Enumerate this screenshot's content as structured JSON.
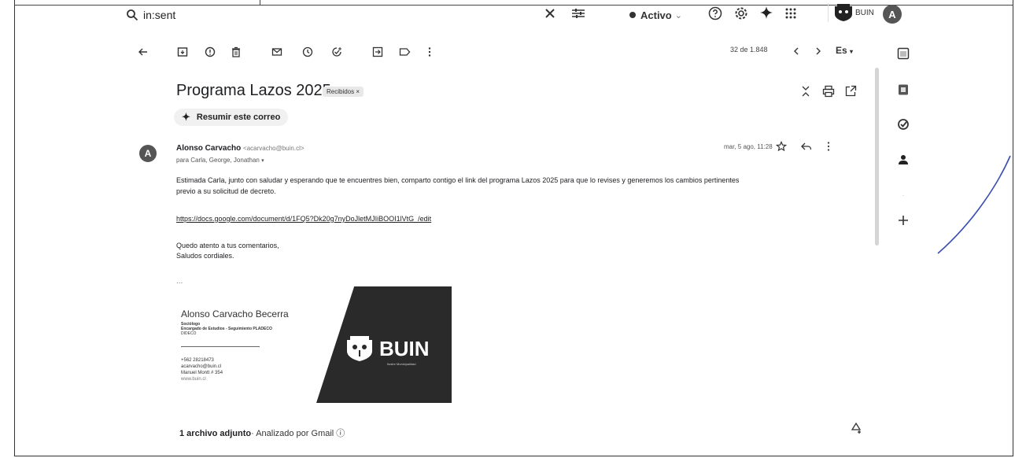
{
  "search": {
    "query": "in:sent"
  },
  "status": {
    "label": "Activo"
  },
  "account": {
    "brand": "BUIN",
    "avatar_letter": "A"
  },
  "toolbar": {
    "pager": "32 de 1.848",
    "lang": "Es"
  },
  "message": {
    "subject": "Programa Lazos 2025",
    "label_tag": "Recibidos ×",
    "summarize": "Resumir este correo",
    "sender_name": "Alonso Carvacho",
    "sender_email": "<acarvacho@buin.cl>",
    "recipients": "para Carla, George, Jonathan",
    "date": "mar, 5 ago, 11:28",
    "avatar_letter": "A",
    "body_line1": "Estimada Carla, junto con saludar y esperando que te encuentres bien, comparto contigo el link del programa Lazos 2025 para que lo revises y generemos los cambios pertinentes",
    "body_line2": "previo a su solicitud de decreto.",
    "link": "https://docs.google.com/document/d/1FQ5?Dk20g7nyDoJletMJIiBOOI1lVtG_/edit",
    "closing1": "Quedo atento a tus comentarios,",
    "closing2": "Saludos cordiales.",
    "sig_dots": "..."
  },
  "signature": {
    "name": "Alonso Carvacho Becerra",
    "role1": "Sociólogo",
    "role2": "Encargado de Estudios - Seguimiento PLADECO",
    "role3": "DIDECO",
    "phone": "+562 28218473",
    "email": "acarvacho@buin.cl",
    "address": "Manuel Montt # 354",
    "web": "www.buin.cl",
    "logo": "BUIN",
    "logo_sub": "Ilustre Municipalidad"
  },
  "attachment": {
    "count_label": "1 archivo adjunto",
    "scan_label": "· Analizado por Gmail ⓘ"
  },
  "colors": {
    "accent": "#202124",
    "avatar_bg": "#555555"
  }
}
